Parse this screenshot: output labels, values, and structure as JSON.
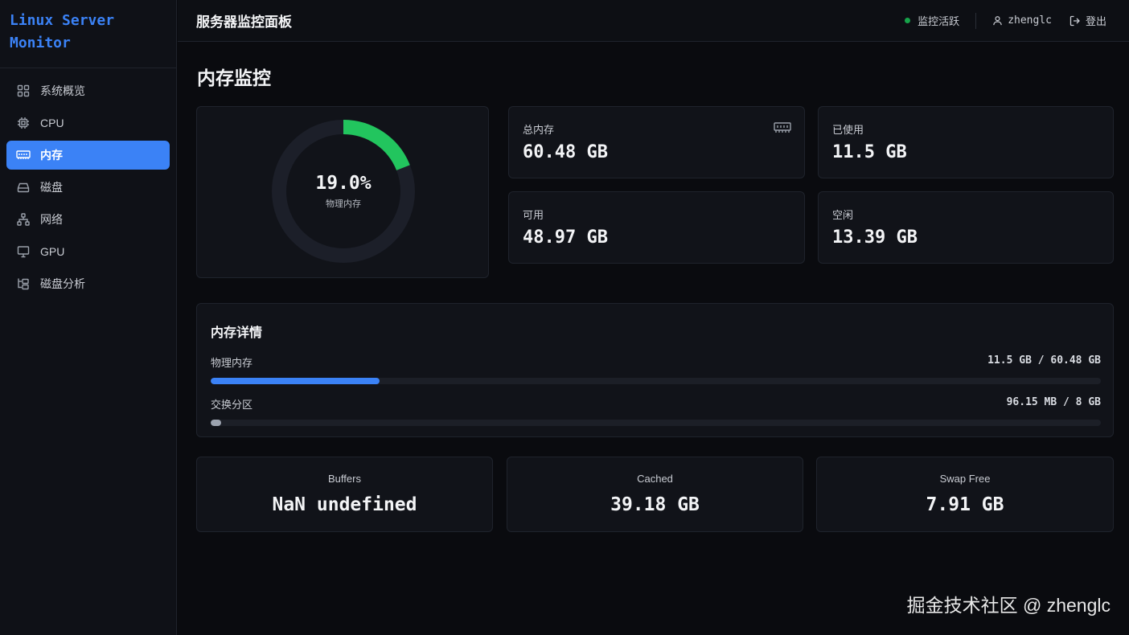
{
  "brand": {
    "line1": "Linux Server",
    "line2": "Monitor",
    "color": "#3b82f6"
  },
  "sidebar": {
    "items": [
      {
        "label": "系统概览",
        "icon": "grid-icon",
        "active": false
      },
      {
        "label": "CPU",
        "icon": "cpu-icon",
        "active": false
      },
      {
        "label": "内存",
        "icon": "memory-icon",
        "active": true
      },
      {
        "label": "磁盘",
        "icon": "hard-drive-icon",
        "active": false
      },
      {
        "label": "网络",
        "icon": "network-icon",
        "active": false
      },
      {
        "label": "GPU",
        "icon": "monitor-icon",
        "active": false
      },
      {
        "label": "磁盘分析",
        "icon": "folder-tree-icon",
        "active": false
      }
    ]
  },
  "header": {
    "title": "服务器监控面板",
    "status": "监控活跃",
    "status_color": "#16a34a",
    "user": "zhenglc",
    "logout": "登出"
  },
  "main": {
    "title": "内存监控",
    "gauge": {
      "value_text": "19.0%",
      "percent": 19.0,
      "label": "物理内存",
      "color": "#22c55e"
    },
    "stats": [
      {
        "label": "总内存",
        "value": "60.48 GB",
        "icon": "memory-icon"
      },
      {
        "label": "已使用",
        "value": "11.5 GB"
      },
      {
        "label": "可用",
        "value": "48.97 GB"
      },
      {
        "label": "空闲",
        "value": "13.39 GB"
      }
    ],
    "details": {
      "title": "内存详情",
      "bars": [
        {
          "label": "物理内存",
          "value": "11.5 GB / 60.48 GB",
          "fraction": 0.19,
          "color": "#3b82f6"
        },
        {
          "label": "交换分区",
          "value": "96.15 MB / 8 GB",
          "fraction": 0.012,
          "color": "#9ca3af"
        }
      ]
    },
    "mini": [
      {
        "label": "Buffers",
        "value": "NaN undefined"
      },
      {
        "label": "Cached",
        "value": "39.18 GB"
      },
      {
        "label": "Swap Free",
        "value": "7.91 GB"
      }
    ]
  },
  "watermark": "掘金技术社区 @ zhenglc"
}
